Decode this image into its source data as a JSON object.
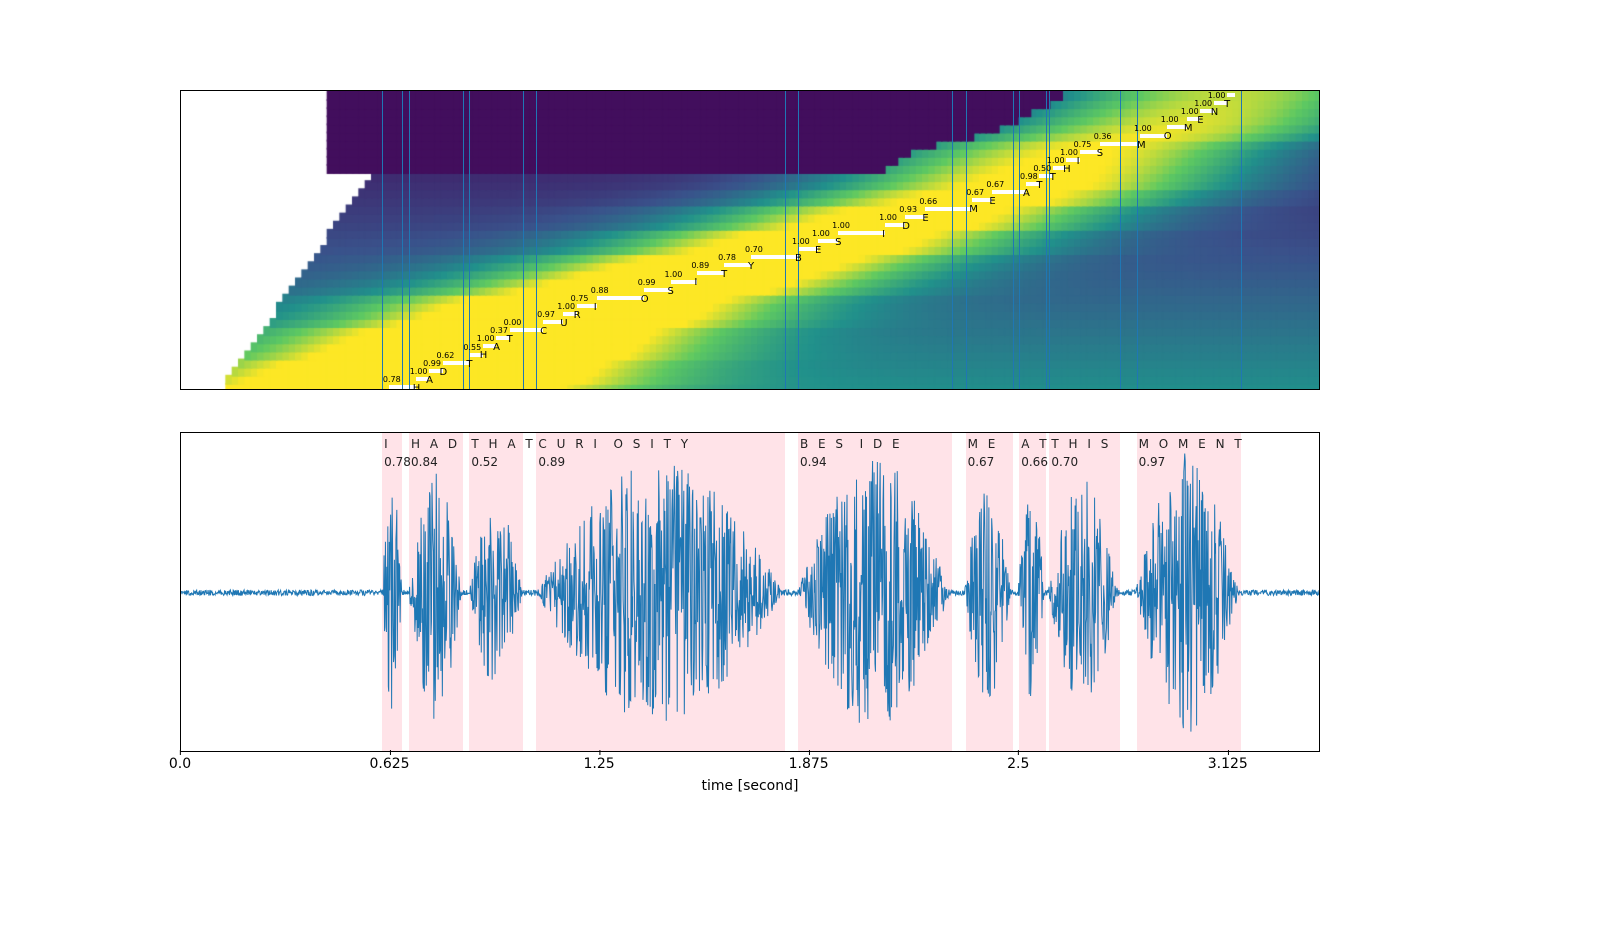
{
  "xlabel": "time [second]",
  "xticks": [
    {
      "t": 0.0,
      "label": "0.0"
    },
    {
      "t": 0.625,
      "label": "0.625"
    },
    {
      "t": 1.25,
      "label": "1.25"
    },
    {
      "t": 1.875,
      "label": "1.875"
    },
    {
      "t": 2.5,
      "label": "2.5"
    },
    {
      "t": 3.125,
      "label": "3.125"
    }
  ],
  "time_range": [
    0.0,
    3.4
  ],
  "chart_data": {
    "type": "alignment+waveform",
    "text": "I HAD THAT CURIOSITY BESIDE ME AT THIS MOMENT",
    "xlabel": "time [second]",
    "xlim": [
      0.0,
      3.4
    ],
    "tokens": [
      {
        "ch": "I",
        "t": 0.62,
        "p": 0.78
      },
      {
        "ch": "H",
        "t": 0.7,
        "p": 1.0
      },
      {
        "ch": "A",
        "t": 0.74,
        "p": 0.99
      },
      {
        "ch": "D",
        "t": 0.78,
        "p": 0.62
      },
      {
        "ch": "T",
        "t": 0.86,
        "p": 0.55
      },
      {
        "ch": "H",
        "t": 0.9,
        "p": 1.0
      },
      {
        "ch": "A",
        "t": 0.94,
        "p": 0.37
      },
      {
        "ch": "T",
        "t": 0.98,
        "p": 0.0
      },
      {
        "ch": "C",
        "t": 1.08,
        "p": 0.97
      },
      {
        "ch": "U",
        "t": 1.14,
        "p": 1.0
      },
      {
        "ch": "R",
        "t": 1.18,
        "p": 0.75
      },
      {
        "ch": "I",
        "t": 1.24,
        "p": 0.88
      },
      {
        "ch": "O",
        "t": 1.38,
        "p": 0.99
      },
      {
        "ch": "S",
        "t": 1.46,
        "p": 1.0
      },
      {
        "ch": "I",
        "t": 1.54,
        "p": 0.89
      },
      {
        "ch": "T",
        "t": 1.62,
        "p": 0.78
      },
      {
        "ch": "Y",
        "t": 1.7,
        "p": 0.7
      },
      {
        "ch": "B",
        "t": 1.84,
        "p": 1.0
      },
      {
        "ch": "E",
        "t": 1.9,
        "p": 1.0
      },
      {
        "ch": "S",
        "t": 1.96,
        "p": 1.0
      },
      {
        "ch": "I",
        "t": 2.1,
        "p": 1.0
      },
      {
        "ch": "D",
        "t": 2.16,
        "p": 0.93
      },
      {
        "ch": "E",
        "t": 2.22,
        "p": 0.66
      },
      {
        "ch": "M",
        "t": 2.36,
        "p": 0.67
      },
      {
        "ch": "E",
        "t": 2.42,
        "p": 0.67
      },
      {
        "ch": "A",
        "t": 2.52,
        "p": 0.98
      },
      {
        "ch": "T",
        "t": 2.56,
        "p": 0.5
      },
      {
        "ch": "T",
        "t": 2.6,
        "p": 1.0
      },
      {
        "ch": "H",
        "t": 2.64,
        "p": 1.0
      },
      {
        "ch": "I",
        "t": 2.68,
        "p": 0.75
      },
      {
        "ch": "S",
        "t": 2.74,
        "p": 0.36
      },
      {
        "ch": "M",
        "t": 2.86,
        "p": 1.0
      },
      {
        "ch": "O",
        "t": 2.94,
        "p": 1.0
      },
      {
        "ch": "M",
        "t": 3.0,
        "p": 1.0
      },
      {
        "ch": "E",
        "t": 3.04,
        "p": 1.0
      },
      {
        "ch": "N",
        "t": 3.08,
        "p": 1.0
      },
      {
        "ch": "T",
        "t": 3.12,
        "p": 1.0
      }
    ],
    "words": [
      {
        "word": "I",
        "t0": 0.6,
        "t1": 0.66,
        "p": 0.78
      },
      {
        "word": "HAD",
        "t0": 0.68,
        "t1": 0.84,
        "p": 0.84
      },
      {
        "word": "THAT",
        "t0": 0.86,
        "t1": 1.02,
        "p": 0.52
      },
      {
        "word": "CURIOSITY",
        "t0": 1.06,
        "t1": 1.8,
        "p": 0.89
      },
      {
        "word": "BESIDE",
        "t0": 1.84,
        "t1": 2.3,
        "p": 0.94
      },
      {
        "word": "ME",
        "t0": 2.34,
        "t1": 2.48,
        "p": 0.67
      },
      {
        "word": "AT",
        "t0": 2.5,
        "t1": 2.58,
        "p": 0.66
      },
      {
        "word": "THIS",
        "t0": 2.59,
        "t1": 2.8,
        "p": 0.7
      },
      {
        "word": "MOMENT",
        "t0": 2.85,
        "t1": 3.16,
        "p": 0.97
      }
    ],
    "word_char_splits": {
      "I": [
        "I"
      ],
      "HAD": [
        "H",
        "A",
        "D"
      ],
      "THAT": [
        "T",
        "H",
        "A",
        "T"
      ],
      "CURIOSITY": [
        "C",
        "U",
        "R",
        "I",
        "",
        "O",
        "S",
        "I",
        "T",
        "Y"
      ],
      "BESIDE": [
        "B",
        "E",
        "S",
        "",
        "I",
        "D",
        "E"
      ],
      "ME": [
        "M",
        "E"
      ],
      "AT": [
        "A",
        "T"
      ],
      "THIS": [
        "T",
        "H",
        "I",
        "S"
      ],
      "MOMENT": [
        "M",
        "O",
        "M",
        "E",
        "N",
        "T"
      ]
    },
    "waveform_envelope_note": "Audio waveform amplitude roughly zero before ~0.6s and after ~3.2s; large bursts align with each word band."
  }
}
